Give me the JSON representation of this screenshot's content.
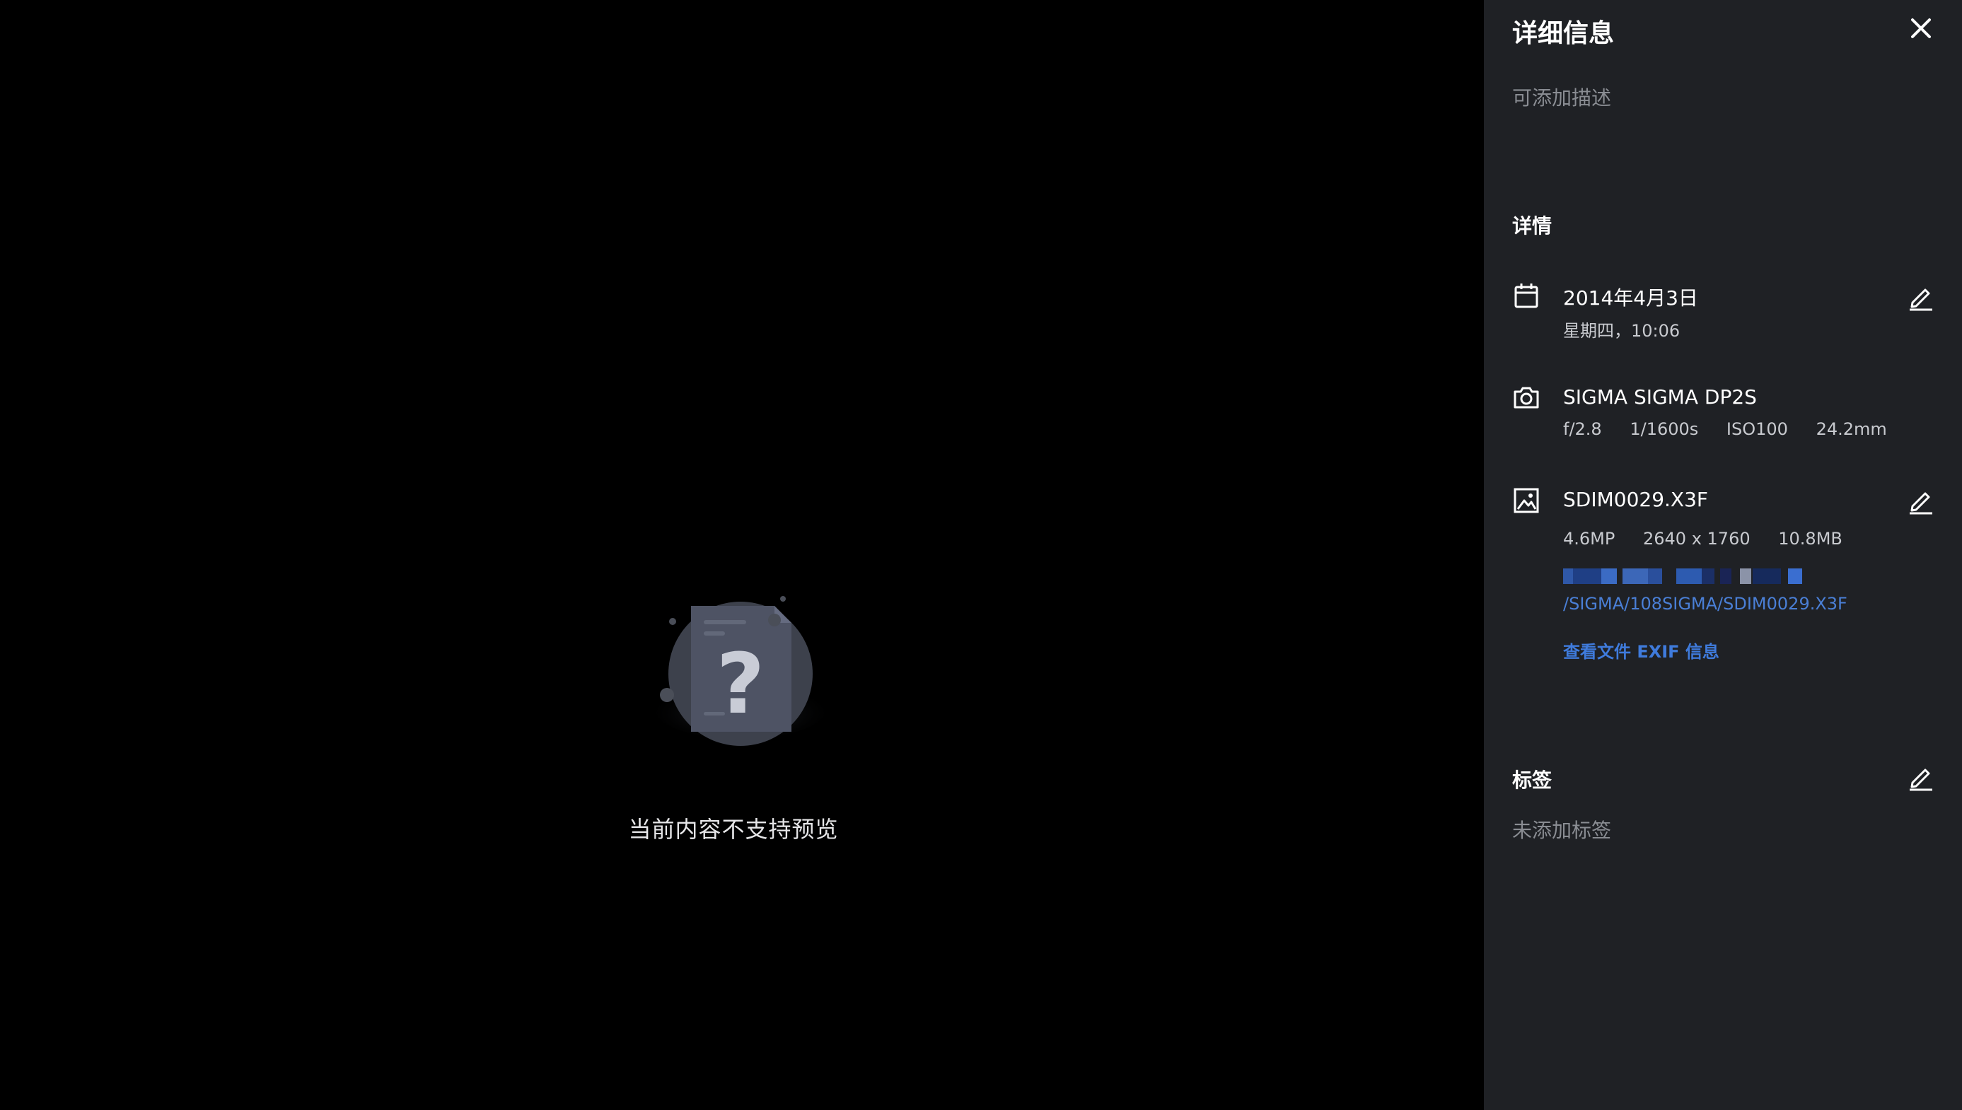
{
  "viewer": {
    "message": "当前内容不支持预览"
  },
  "panel": {
    "title": "详细信息",
    "description_placeholder": "可添加描述",
    "details_heading": "详情",
    "date": {
      "icon": "calendar-icon",
      "primary": "2014年4月3日",
      "secondary": "星期四，10:06"
    },
    "camera": {
      "icon": "camera-icon",
      "primary": "SIGMA SIGMA DP2S",
      "aperture": "f/2.8",
      "shutter": "1/1600s",
      "iso": "ISO100",
      "focal": "24.2mm"
    },
    "file": {
      "icon": "image-icon",
      "name": "SDIM0029.X3F",
      "megapixels": "4.6MP",
      "dimensions": "2640 x 1760",
      "size": "10.8MB",
      "path_visible": "/SIGMA/108SIGMA/SDIM0029.X3F",
      "exif_link": "查看文件 EXIF 信息"
    },
    "tags_heading": "标签",
    "tags_empty": "未添加标签"
  },
  "colors": {
    "panel_bg": "#1f2125",
    "link": "#3f7bdc",
    "muted": "#8a8d93"
  }
}
